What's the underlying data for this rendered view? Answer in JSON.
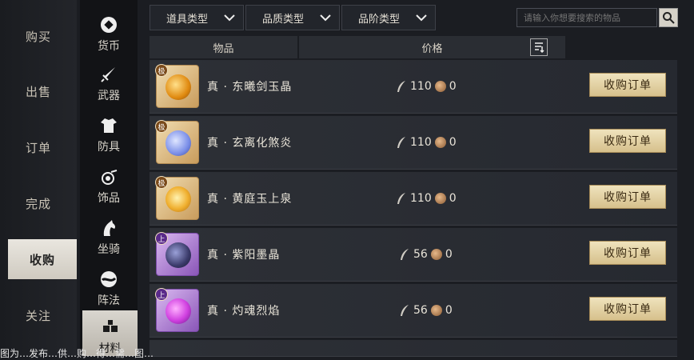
{
  "left_nav": {
    "items": [
      {
        "label": "购买"
      },
      {
        "label": "出售"
      },
      {
        "label": "订单"
      },
      {
        "label": "完成"
      },
      {
        "label": "收购"
      },
      {
        "label": "关注"
      }
    ],
    "active_index": 4
  },
  "categories": {
    "items": [
      {
        "label": "货币",
        "icon": "currency-icon"
      },
      {
        "label": "武器",
        "icon": "sword-icon"
      },
      {
        "label": "防具",
        "icon": "armor-icon"
      },
      {
        "label": "饰品",
        "icon": "accessory-icon"
      },
      {
        "label": "坐骑",
        "icon": "horse-icon"
      },
      {
        "label": "阵法",
        "icon": "formation-icon"
      },
      {
        "label": "材料",
        "icon": "material-icon"
      }
    ],
    "active_index": 6
  },
  "filters": {
    "item_type": "道具类型",
    "quality_type": "品质类型",
    "grade_type": "品阶类型"
  },
  "search": {
    "placeholder": "请输入你想要搜索的物品"
  },
  "table": {
    "col_item": "物品",
    "col_price": "价格",
    "buy_label": "收购订单",
    "rows": [
      {
        "grade": "极",
        "quality": "gold",
        "name": "真 · 东曦剑玉晶",
        "price": "110",
        "price2": "0",
        "orb_color": "#f0a020"
      },
      {
        "grade": "极",
        "quality": "gold",
        "name": "真 · 玄离化煞炎",
        "price": "110",
        "price2": "0",
        "orb_color": "#7a8ee8"
      },
      {
        "grade": "极",
        "quality": "gold",
        "name": "真 · 黄庭玉上泉",
        "price": "110",
        "price2": "0",
        "orb_color": "#f0b030"
      },
      {
        "grade": "上",
        "quality": "purple",
        "name": "真 · 紫阳墨晶",
        "price": "56",
        "price2": "0",
        "orb_color": "#3a3a6a"
      },
      {
        "grade": "上",
        "quality": "purple",
        "name": "真 · 灼魂烈焰",
        "price": "56",
        "price2": "0",
        "orb_color": "#d040e0"
      }
    ]
  },
  "overlay_caption": "图为…发布…供…购…得…需…图…"
}
